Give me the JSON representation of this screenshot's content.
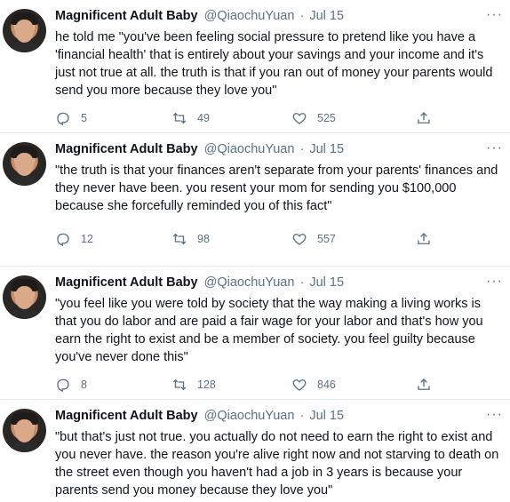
{
  "author": {
    "name": "Magnificent Adult Baby",
    "handle": "@QiaochuYuan",
    "separator": "·"
  },
  "more_glyph": "···",
  "tweets": [
    {
      "date": "Jul 15",
      "text": "he told me \"you've been feeling social pressure to pretend like you have a 'financial health' that is entirely about your savings and your income and it's just not true at all. the truth is that if you ran out of money your parents would send you more because they love you\"",
      "replies": "5",
      "retweets": "49",
      "likes": "525"
    },
    {
      "date": "Jul 15",
      "text": "\"the truth is that your finances aren't separate from your parents' finances and they never have been. you resent your mom for sending you $100,000 because she forcefully reminded you of this fact\"",
      "replies": "12",
      "retweets": "98",
      "likes": "557"
    },
    {
      "date": "Jul 15",
      "text": "\"you feel like you were told by society that the way making a living works is that you do labor and are paid a fair wage for your labor and that's how you earn the right to exist and be a member of society. you feel guilty because you've never done this\"",
      "replies": "8",
      "retweets": "128",
      "likes": "846"
    },
    {
      "date": "Jul 15",
      "text": "\"but that's just not true. you actually do not need to earn the right to exist and you never have. the reason you're alive right now and not starving to death on the street even though you haven't had a job in 3 years is because your parents send you money because they love you\""
    }
  ]
}
